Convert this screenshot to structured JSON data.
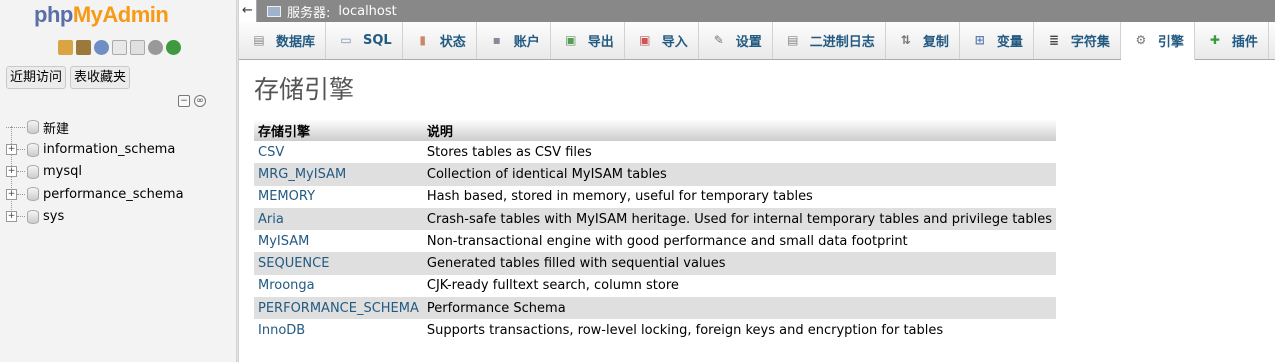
{
  "nav": {
    "logo_part1": "php",
    "logo_part2": "MyAdmin",
    "icons": [
      "home-icon",
      "exit-icon",
      "help-icon",
      "docs-icon",
      "copy-icon",
      "settings-icon",
      "reload-icon"
    ],
    "recent_label": "近期访问",
    "favorites_label": "表收藏夹",
    "tree": [
      {
        "label": "新建",
        "type": "new"
      },
      {
        "label": "information_schema",
        "type": "db"
      },
      {
        "label": "mysql",
        "type": "db"
      },
      {
        "label": "performance_schema",
        "type": "db"
      },
      {
        "label": "sys",
        "type": "db"
      }
    ]
  },
  "topbar": {
    "server_label": "服务器:",
    "server_value": "localhost"
  },
  "tabs": [
    {
      "label": "数据库",
      "icon": "database-icon",
      "glyph": "▤",
      "color": "#888"
    },
    {
      "label": "SQL",
      "icon": "sql-icon",
      "glyph": "▭",
      "color": "#7a8fb0"
    },
    {
      "label": "状态",
      "icon": "status-icon",
      "glyph": "▮",
      "color": "#c86"
    },
    {
      "label": "账户",
      "icon": "users-icon",
      "glyph": "▪",
      "color": "#889"
    },
    {
      "label": "导出",
      "icon": "export-icon",
      "glyph": "▣",
      "color": "#5a9a5a"
    },
    {
      "label": "导入",
      "icon": "import-icon",
      "glyph": "▣",
      "color": "#c55"
    },
    {
      "label": "设置",
      "icon": "wrench-icon",
      "glyph": "✎",
      "color": "#777"
    },
    {
      "label": "二进制日志",
      "icon": "binlog-icon",
      "glyph": "▤",
      "color": "#888"
    },
    {
      "label": "复制",
      "icon": "replication-icon",
      "glyph": "⇅",
      "color": "#777"
    },
    {
      "label": "变量",
      "icon": "variables-icon",
      "glyph": "⊞",
      "color": "#5a7fb0"
    },
    {
      "label": "字符集",
      "icon": "charset-icon",
      "glyph": "≣",
      "color": "#444"
    },
    {
      "label": "引擎",
      "icon": "engine-icon",
      "glyph": "⚙",
      "color": "#777",
      "active": true
    },
    {
      "label": "插件",
      "icon": "plugin-icon",
      "glyph": "✚",
      "color": "#3a9a3a"
    }
  ],
  "page": {
    "title": "存储引擎",
    "col_engine": "存储引擎",
    "col_desc": "说明"
  },
  "engines": [
    {
      "name": "CSV",
      "desc": "Stores tables as CSV files"
    },
    {
      "name": "MRG_MyISAM",
      "desc": "Collection of identical MyISAM tables"
    },
    {
      "name": "MEMORY",
      "desc": "Hash based, stored in memory, useful for temporary tables"
    },
    {
      "name": "Aria",
      "desc": "Crash-safe tables with MyISAM heritage. Used for internal temporary tables and privilege tables"
    },
    {
      "name": "MyISAM",
      "desc": "Non-transactional engine with good performance and small data footprint"
    },
    {
      "name": "SEQUENCE",
      "desc": "Generated tables filled with sequential values"
    },
    {
      "name": "Mroonga",
      "desc": "CJK-ready fulltext search, column store"
    },
    {
      "name": "PERFORMANCE_SCHEMA",
      "desc": "Performance Schema"
    },
    {
      "name": "InnoDB",
      "desc": "Supports transactions, row-level locking, foreign keys and encryption for tables"
    }
  ]
}
